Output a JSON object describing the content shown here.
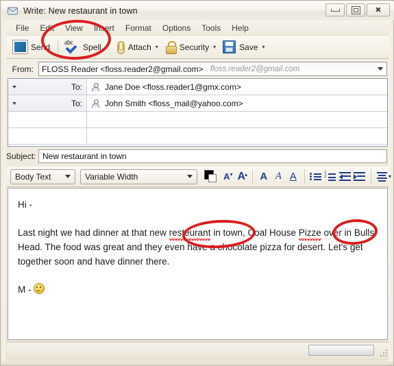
{
  "window": {
    "title": "Write: New restaurant in town",
    "app_icon": "envelope-icon",
    "buttons": {
      "minimize": "minimize-icon",
      "restore": "restore-icon",
      "close": "close-icon"
    }
  },
  "menubar": {
    "items": [
      {
        "label": "File"
      },
      {
        "label": "Edit"
      },
      {
        "label": "View"
      },
      {
        "label": "Insert"
      },
      {
        "label": "Format"
      },
      {
        "label": "Options"
      },
      {
        "label": "Tools"
      },
      {
        "label": "Help"
      }
    ]
  },
  "toolbar": {
    "send": {
      "label": "Send",
      "icon": "send-envelope-icon"
    },
    "spell": {
      "label": "Spell",
      "icon": "spellcheck-abc-icon",
      "caret": "▾"
    },
    "attach": {
      "label": "Attach",
      "icon": "paperclip-icon",
      "caret": "▾"
    },
    "security": {
      "label": "Security",
      "icon": "padlock-icon",
      "caret": "▾"
    },
    "save": {
      "label": "Save",
      "icon": "floppy-disk-icon",
      "caret": "▾"
    }
  },
  "headers": {
    "from_label": "From:",
    "from_value": "FLOSS Reader <floss.reader2@gmail.com>",
    "from_account": "floss.reader2@gmail.com",
    "recipients": [
      {
        "type": "To:",
        "value": "Jane Doe <floss.reader1@gmx.com>",
        "icon": "person-icon"
      },
      {
        "type": "To:",
        "value": "John Smith <floss_mail@yahoo.com>",
        "icon": "person-icon"
      },
      {
        "type": "",
        "value": "",
        "icon": ""
      },
      {
        "type": "",
        "value": "",
        "icon": ""
      }
    ],
    "subject_label": "Subject:",
    "subject_value": "New restaurant in town"
  },
  "format_toolbar": {
    "paragraph_style": "Body Text",
    "font_family": "Variable Width",
    "color_swatch": {
      "foreground": "#000000",
      "background": "#ffffff"
    },
    "buttons": [
      {
        "name": "decrease-font-size-button",
        "label": "A"
      },
      {
        "name": "increase-font-size-button",
        "label": "A"
      },
      {
        "name": "bold-button",
        "label": "A"
      },
      {
        "name": "italic-button",
        "label": "A"
      },
      {
        "name": "underline-button",
        "label": "A"
      },
      {
        "name": "bullet-list-button",
        "label": ""
      },
      {
        "name": "numbered-list-button",
        "label": ""
      },
      {
        "name": "outdent-button",
        "label": ""
      },
      {
        "name": "indent-button",
        "label": ""
      },
      {
        "name": "align-button",
        "label": ""
      }
    ]
  },
  "body": {
    "greeting": "Hi -",
    "paragraph_before": "Last night we had dinner at that new ",
    "misspelled_1": "resteurant",
    "paragraph_middle": " in town, Coal House ",
    "misspelled_2": "Pizze",
    "paragraph_after": " over in Bulls Head. The food was great and they even have a chocolate pizza for desert. Let's get together soon and have dinner there.",
    "signature": "M - ",
    "signature_emoji": "smiley-face-icon"
  },
  "status": {
    "progress_value": "",
    "resize_grip": "resize-grip-icon"
  },
  "annotations": {
    "colors": {
      "highlight": "#d81f22"
    },
    "items": [
      {
        "name": "annotation-ellipse-spell-button",
        "target": "Spell"
      },
      {
        "name": "annotation-ellipse-misspelled-resteurant",
        "target": "resteurant"
      },
      {
        "name": "annotation-ellipse-misspelled-pizze",
        "target": "Pizze"
      }
    ]
  }
}
